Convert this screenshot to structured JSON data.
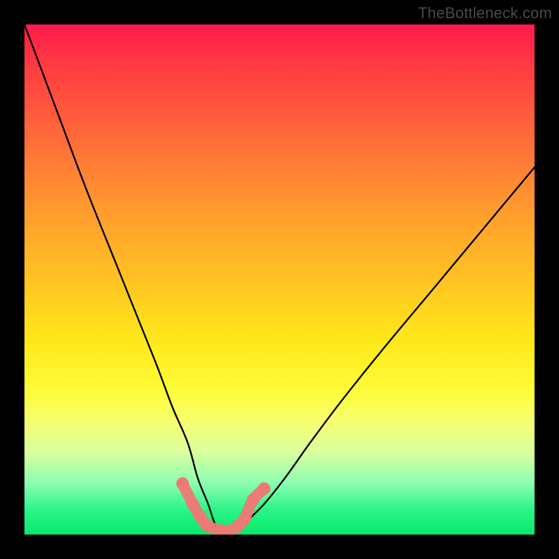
{
  "watermark": "TheBottleneck.com",
  "chart_data": {
    "type": "line",
    "title": "",
    "xlabel": "",
    "ylabel": "",
    "xlim": [
      0,
      100
    ],
    "ylim": [
      0,
      100
    ],
    "grid": false,
    "legend": false,
    "series": [
      {
        "name": "bottleneck-curve",
        "x": [
          0,
          6,
          12,
          18,
          22,
          26,
          29,
          32,
          34,
          36,
          37,
          38,
          40,
          42,
          44,
          47,
          51,
          56,
          62,
          70,
          80,
          90,
          100
        ],
        "values": [
          100,
          84,
          68,
          53,
          43,
          33,
          25,
          18,
          11,
          6,
          3,
          1,
          1,
          1,
          3,
          6,
          11,
          18,
          26,
          36,
          48,
          60,
          72
        ]
      },
      {
        "name": "bottom-marker-dots",
        "x": [
          31.0,
          33.0,
          34.5,
          35.8,
          38.5,
          40.5,
          42.0,
          43.2,
          44.8,
          47.0
        ],
        "values": [
          10.0,
          6.0,
          3.5,
          1.8,
          0.8,
          0.8,
          1.8,
          3.2,
          6.8,
          9.0
        ]
      }
    ],
    "colors": {
      "curve": "#000000",
      "points": "#ed7a74",
      "gradient_top": "#ff1a4b",
      "gradient_bottom": "#06e96a"
    }
  }
}
